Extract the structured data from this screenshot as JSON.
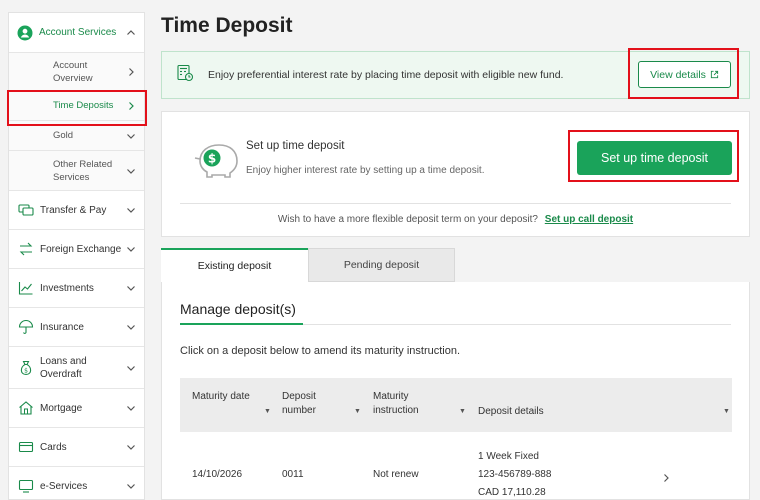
{
  "page": {
    "title": "Time Deposit"
  },
  "sidebar": {
    "top": {
      "label": "Account Services"
    },
    "sub_items": [
      {
        "label": "Account Overview"
      },
      {
        "label": "Time Deposits"
      },
      {
        "label": "Gold"
      },
      {
        "label": "Other Related Services"
      }
    ],
    "items": [
      {
        "label": "Transfer & Pay"
      },
      {
        "label": "Foreign Exchange"
      },
      {
        "label": "Investments"
      },
      {
        "label": "Insurance"
      },
      {
        "label": "Loans and Overdraft"
      },
      {
        "label": "Mortgage"
      },
      {
        "label": "Cards"
      },
      {
        "label": "e-Services"
      }
    ]
  },
  "promo": {
    "text": "Enjoy preferential interest rate by placing time deposit with eligible new fund.",
    "button": "View details"
  },
  "setup": {
    "title": "Set up time deposit",
    "subtitle": "Enjoy higher interest rate by setting up a time deposit.",
    "button": "Set up time deposit",
    "footer_text": "Wish to have a more flexible deposit term on your deposit?",
    "footer_link": "Set up call deposit"
  },
  "tabs": [
    {
      "label": "Existing deposit"
    },
    {
      "label": "Pending deposit"
    }
  ],
  "manage": {
    "title": "Manage deposit(s)",
    "hint": "Click on a deposit below to amend its maturity instruction."
  },
  "table": {
    "headers": [
      "Maturity date",
      "Deposit number",
      "Maturity instruction",
      "Deposit details"
    ],
    "rows": [
      {
        "maturity_date": "14/10/2026",
        "deposit_number": "0011",
        "instruction": "Not renew",
        "details_type": "1 Week Fixed",
        "details_account": "123-456789-888",
        "details_amount": "CAD 17,110.28"
      }
    ]
  }
}
